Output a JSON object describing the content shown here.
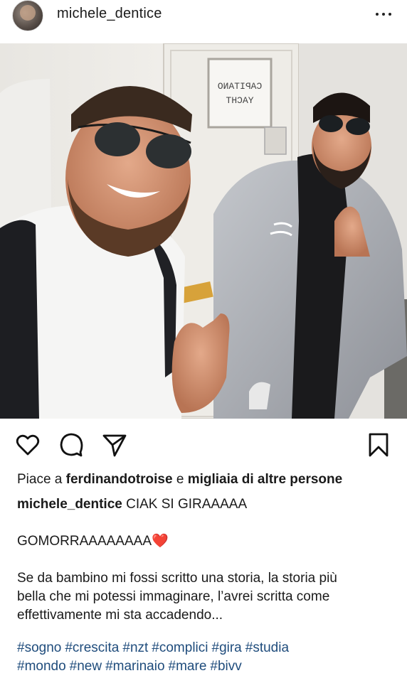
{
  "post": {
    "username": "michele_dentice",
    "photo_sign_text": [
      "CAPITANO",
      "YACHT"
    ]
  },
  "likes": {
    "prefix": "Piace a ",
    "user": "ferdinandotroise",
    "connector": " e ",
    "others": "migliaia di altre persone"
  },
  "caption": {
    "author": "michele_dentice",
    "line1": " CIAK SI GIRAAAAA",
    "line2": "GOMORRAAAAAAAA",
    "line2_emoji": "❤️",
    "paragraph": [
      "Se da bambino mi fossi scritto una storia, la storia più",
      "bella che mi potessi immaginare, l’avrei scritta come",
      "effettivamente mi sta accadendo..."
    ],
    "hashtags_row1": [
      "#sogno",
      "#crescita",
      "#nzt",
      "#complici",
      "#gira",
      "#studia"
    ],
    "hashtags_row2": [
      "#mondo",
      "#new",
      "#marinaio",
      "#mare",
      "#bivv"
    ]
  },
  "icons": {
    "like": "heart-icon",
    "comment": "comment-icon",
    "share": "send-icon",
    "save": "bookmark-icon",
    "options": "more-icon",
    "tag": "user-tag-icon"
  },
  "colors": {
    "hashtag": "#1f4c7c",
    "text": "#1a1a1a"
  }
}
